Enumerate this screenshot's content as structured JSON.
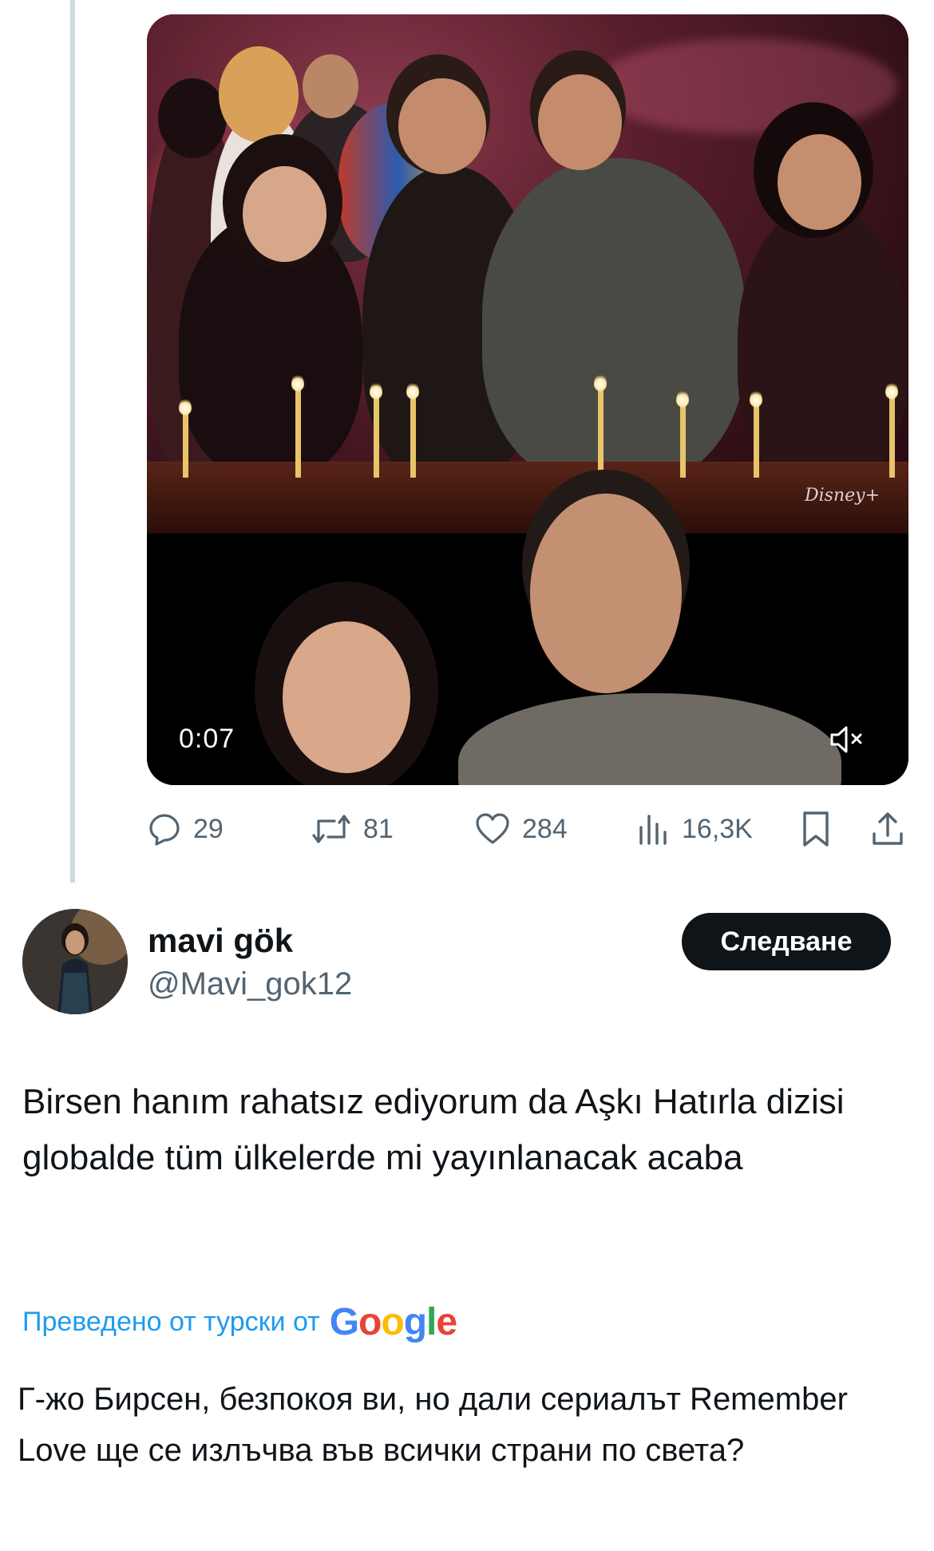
{
  "video": {
    "timestamp": "0:07",
    "watermark": "Disney+"
  },
  "actions": {
    "replies": "29",
    "retweets": "81",
    "likes": "284",
    "views": "16,3K"
  },
  "author": {
    "display_name": "mavi gök",
    "handle": "@Mavi_gok12",
    "follow_label": "Следване"
  },
  "tweet": {
    "text": "Birsen hanım rahatsız ediyorum da Aşkı Hatırla dizisi globalde tüm ülkelerde mi yayınlanacak acaba"
  },
  "translation": {
    "label": "Преведено от турски от",
    "provider": "Google",
    "text": "Г-жо Бирсен, безпокоя ви, но дали сериалът Remember Love ще се излъчва във всички страни по света?"
  },
  "colors": {
    "link": "#1d9bf0",
    "icon_gray": "#536471",
    "text": "#0f1419",
    "button_bg": "#0f1419"
  },
  "icons": [
    "reply-icon",
    "retweet-icon",
    "like-icon",
    "views-icon",
    "bookmark-icon",
    "share-icon",
    "mute-icon"
  ]
}
